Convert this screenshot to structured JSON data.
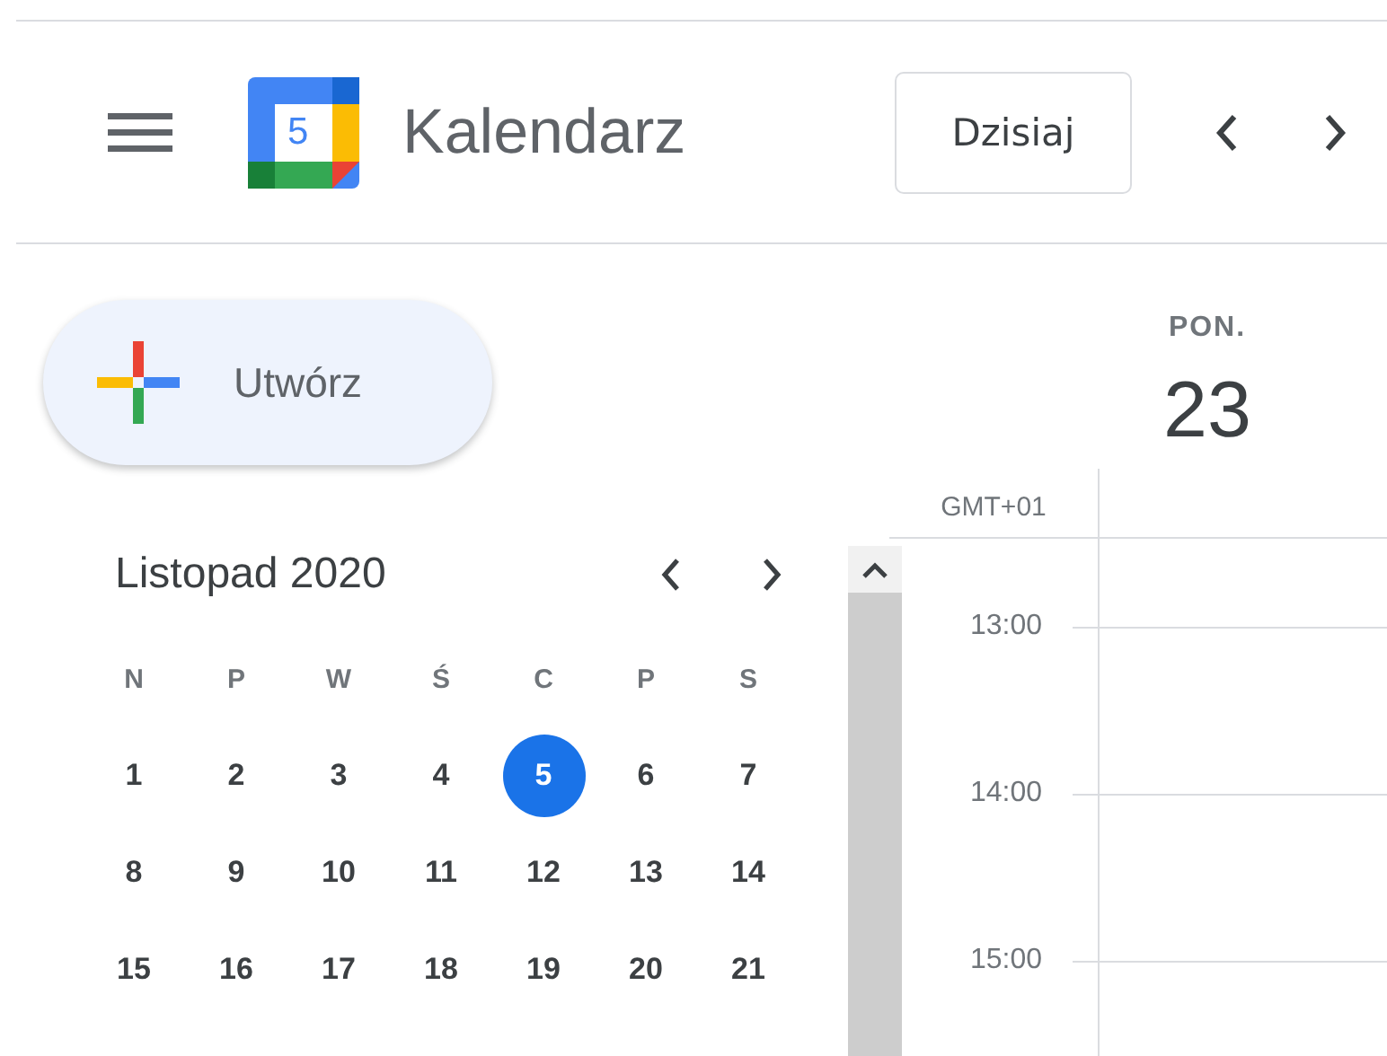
{
  "app": {
    "logo_day": "5",
    "title": "Kalendarz"
  },
  "toolbar": {
    "today_button": "Dzisiaj"
  },
  "create_button": {
    "label": "Utwórz"
  },
  "mini_calendar": {
    "title": "Listopad 2020",
    "weekdays": [
      "N",
      "P",
      "W",
      "Ś",
      "C",
      "P",
      "S"
    ],
    "weeks": [
      [
        {
          "day": "1",
          "selected": false
        },
        {
          "day": "2",
          "selected": false
        },
        {
          "day": "3",
          "selected": false
        },
        {
          "day": "4",
          "selected": false
        },
        {
          "day": "5",
          "selected": true
        },
        {
          "day": "6",
          "selected": false
        },
        {
          "day": "7",
          "selected": false
        }
      ],
      [
        {
          "day": "8",
          "selected": false
        },
        {
          "day": "9",
          "selected": false
        },
        {
          "day": "10",
          "selected": false
        },
        {
          "day": "11",
          "selected": false
        },
        {
          "day": "12",
          "selected": false
        },
        {
          "day": "13",
          "selected": false
        },
        {
          "day": "14",
          "selected": false
        }
      ],
      [
        {
          "day": "15",
          "selected": false
        },
        {
          "day": "16",
          "selected": false
        },
        {
          "day": "17",
          "selected": false
        },
        {
          "day": "18",
          "selected": false
        },
        {
          "day": "19",
          "selected": false
        },
        {
          "day": "20",
          "selected": false
        },
        {
          "day": "21",
          "selected": false
        }
      ]
    ]
  },
  "day_view": {
    "weekday": "PON.",
    "date": "23",
    "timezone": "GMT+01",
    "hours": [
      "13:00",
      "14:00",
      "15:00"
    ]
  }
}
